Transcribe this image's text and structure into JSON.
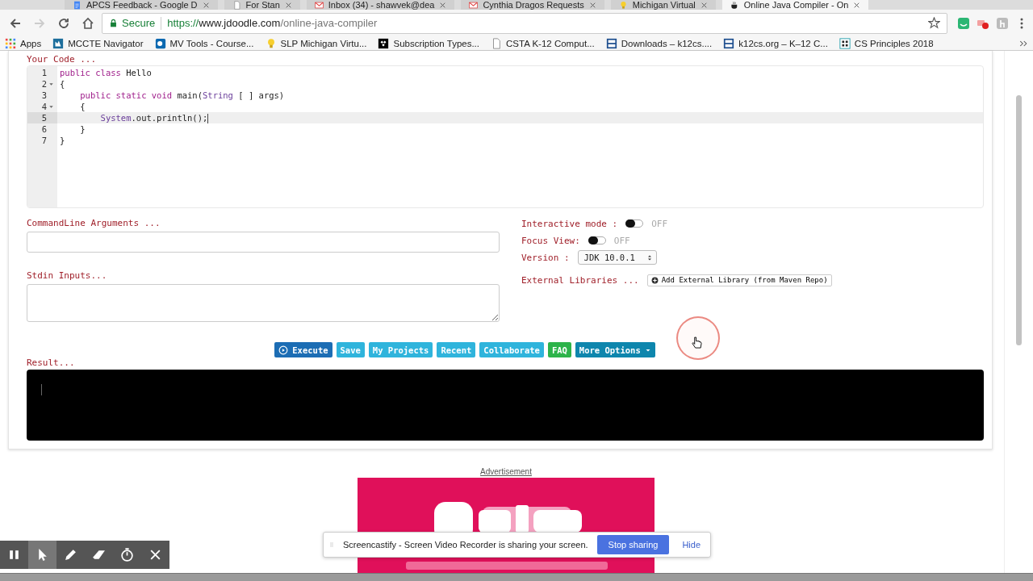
{
  "browser": {
    "tabs": [
      {
        "title": "APCS Feedback - Google D",
        "selected": false
      },
      {
        "title": "For Stan",
        "selected": false
      },
      {
        "title": "Inbox (34) - shawvek@dea",
        "selected": false
      },
      {
        "title": "Cynthia Dragos Requests",
        "selected": false
      },
      {
        "title": "Michigan Virtual",
        "selected": false
      },
      {
        "title": "Online Java Compiler - On",
        "selected": true
      }
    ],
    "address": {
      "secure": "Secure",
      "scheme": "https://",
      "host": "www.jdoodle.com",
      "path": "/online-java-compiler"
    },
    "bookmarks": [
      {
        "label": "Apps"
      },
      {
        "label": "MCCTE Navigator"
      },
      {
        "label": "MV Tools - Course..."
      },
      {
        "label": "SLP Michigan Virtu..."
      },
      {
        "label": "Subscription Types..."
      },
      {
        "label": "CSTA K-12 Comput..."
      },
      {
        "label": "Downloads – k12cs...."
      },
      {
        "label": "k12cs.org – K–12 C..."
      },
      {
        "label": "CS Principles 2018"
      }
    ]
  },
  "editor": {
    "label": "Your Code ...",
    "lines": [
      {
        "number": "1",
        "fold": false,
        "active": false,
        "tokens": [
          {
            "kind": "keyword",
            "text": "public class "
          },
          {
            "kind": "plain",
            "text": "Hello"
          }
        ]
      },
      {
        "number": "2",
        "fold": true,
        "active": false,
        "tokens": [
          {
            "kind": "plain",
            "text": "{"
          }
        ]
      },
      {
        "number": "3",
        "fold": false,
        "active": false,
        "tokens": [
          {
            "kind": "keyword",
            "text": "    public static void "
          },
          {
            "kind": "plain",
            "text": "main("
          },
          {
            "kind": "type",
            "text": "String"
          },
          {
            "kind": "plain",
            "text": " [ ] args)"
          }
        ]
      },
      {
        "number": "4",
        "fold": true,
        "active": false,
        "tokens": [
          {
            "kind": "plain",
            "text": "    {"
          }
        ]
      },
      {
        "number": "5",
        "fold": false,
        "active": true,
        "tokens": [
          {
            "kind": "type",
            "text": "        System"
          },
          {
            "kind": "plain",
            "text": ".out.println();"
          }
        ]
      },
      {
        "number": "6",
        "fold": false,
        "active": false,
        "tokens": [
          {
            "kind": "plain",
            "text": "    }"
          }
        ]
      },
      {
        "number": "7",
        "fold": false,
        "active": false,
        "tokens": [
          {
            "kind": "plain",
            "text": "}"
          }
        ]
      }
    ]
  },
  "arguments": {
    "label": "CommandLine Arguments ..."
  },
  "stdin": {
    "label": "Stdin Inputs..."
  },
  "options": {
    "interactive": {
      "label": "Interactive mode :",
      "on": false,
      "state": "OFF"
    },
    "focus": {
      "label": "Focus View:",
      "on": false,
      "state": "OFF"
    },
    "version": {
      "label": "Version :",
      "value": "JDK 10.0.1"
    },
    "libraries": {
      "label": "External Libraries ...",
      "button": "Add External Library (from Maven Repo)"
    }
  },
  "actions": [
    {
      "label": "Execute",
      "kind": "primary"
    },
    {
      "label": "Save",
      "kind": "info"
    },
    {
      "label": "My Projects",
      "kind": "info"
    },
    {
      "label": "Recent",
      "kind": "info"
    },
    {
      "label": "Collaborate",
      "kind": "info"
    },
    {
      "label": "FAQ",
      "kind": "success"
    },
    {
      "label": "More Options",
      "kind": "dropdown"
    }
  ],
  "result": {
    "label": "Result..."
  },
  "advertisement": {
    "label": "Advertisement",
    "kind": "picture"
  },
  "screencastify": {
    "tools": [
      {
        "kind": "pause",
        "selected": false
      },
      {
        "kind": "pointer",
        "selected": true
      },
      {
        "kind": "pen",
        "selected": false
      },
      {
        "kind": "eraser",
        "selected": false
      },
      {
        "kind": "timer",
        "selected": false
      },
      {
        "kind": "close",
        "selected": false
      }
    ],
    "share_bar": {
      "message": "Screencastify - Screen Video Recorder is sharing your screen.",
      "stop": "Stop sharing",
      "hide": "Hide"
    }
  }
}
